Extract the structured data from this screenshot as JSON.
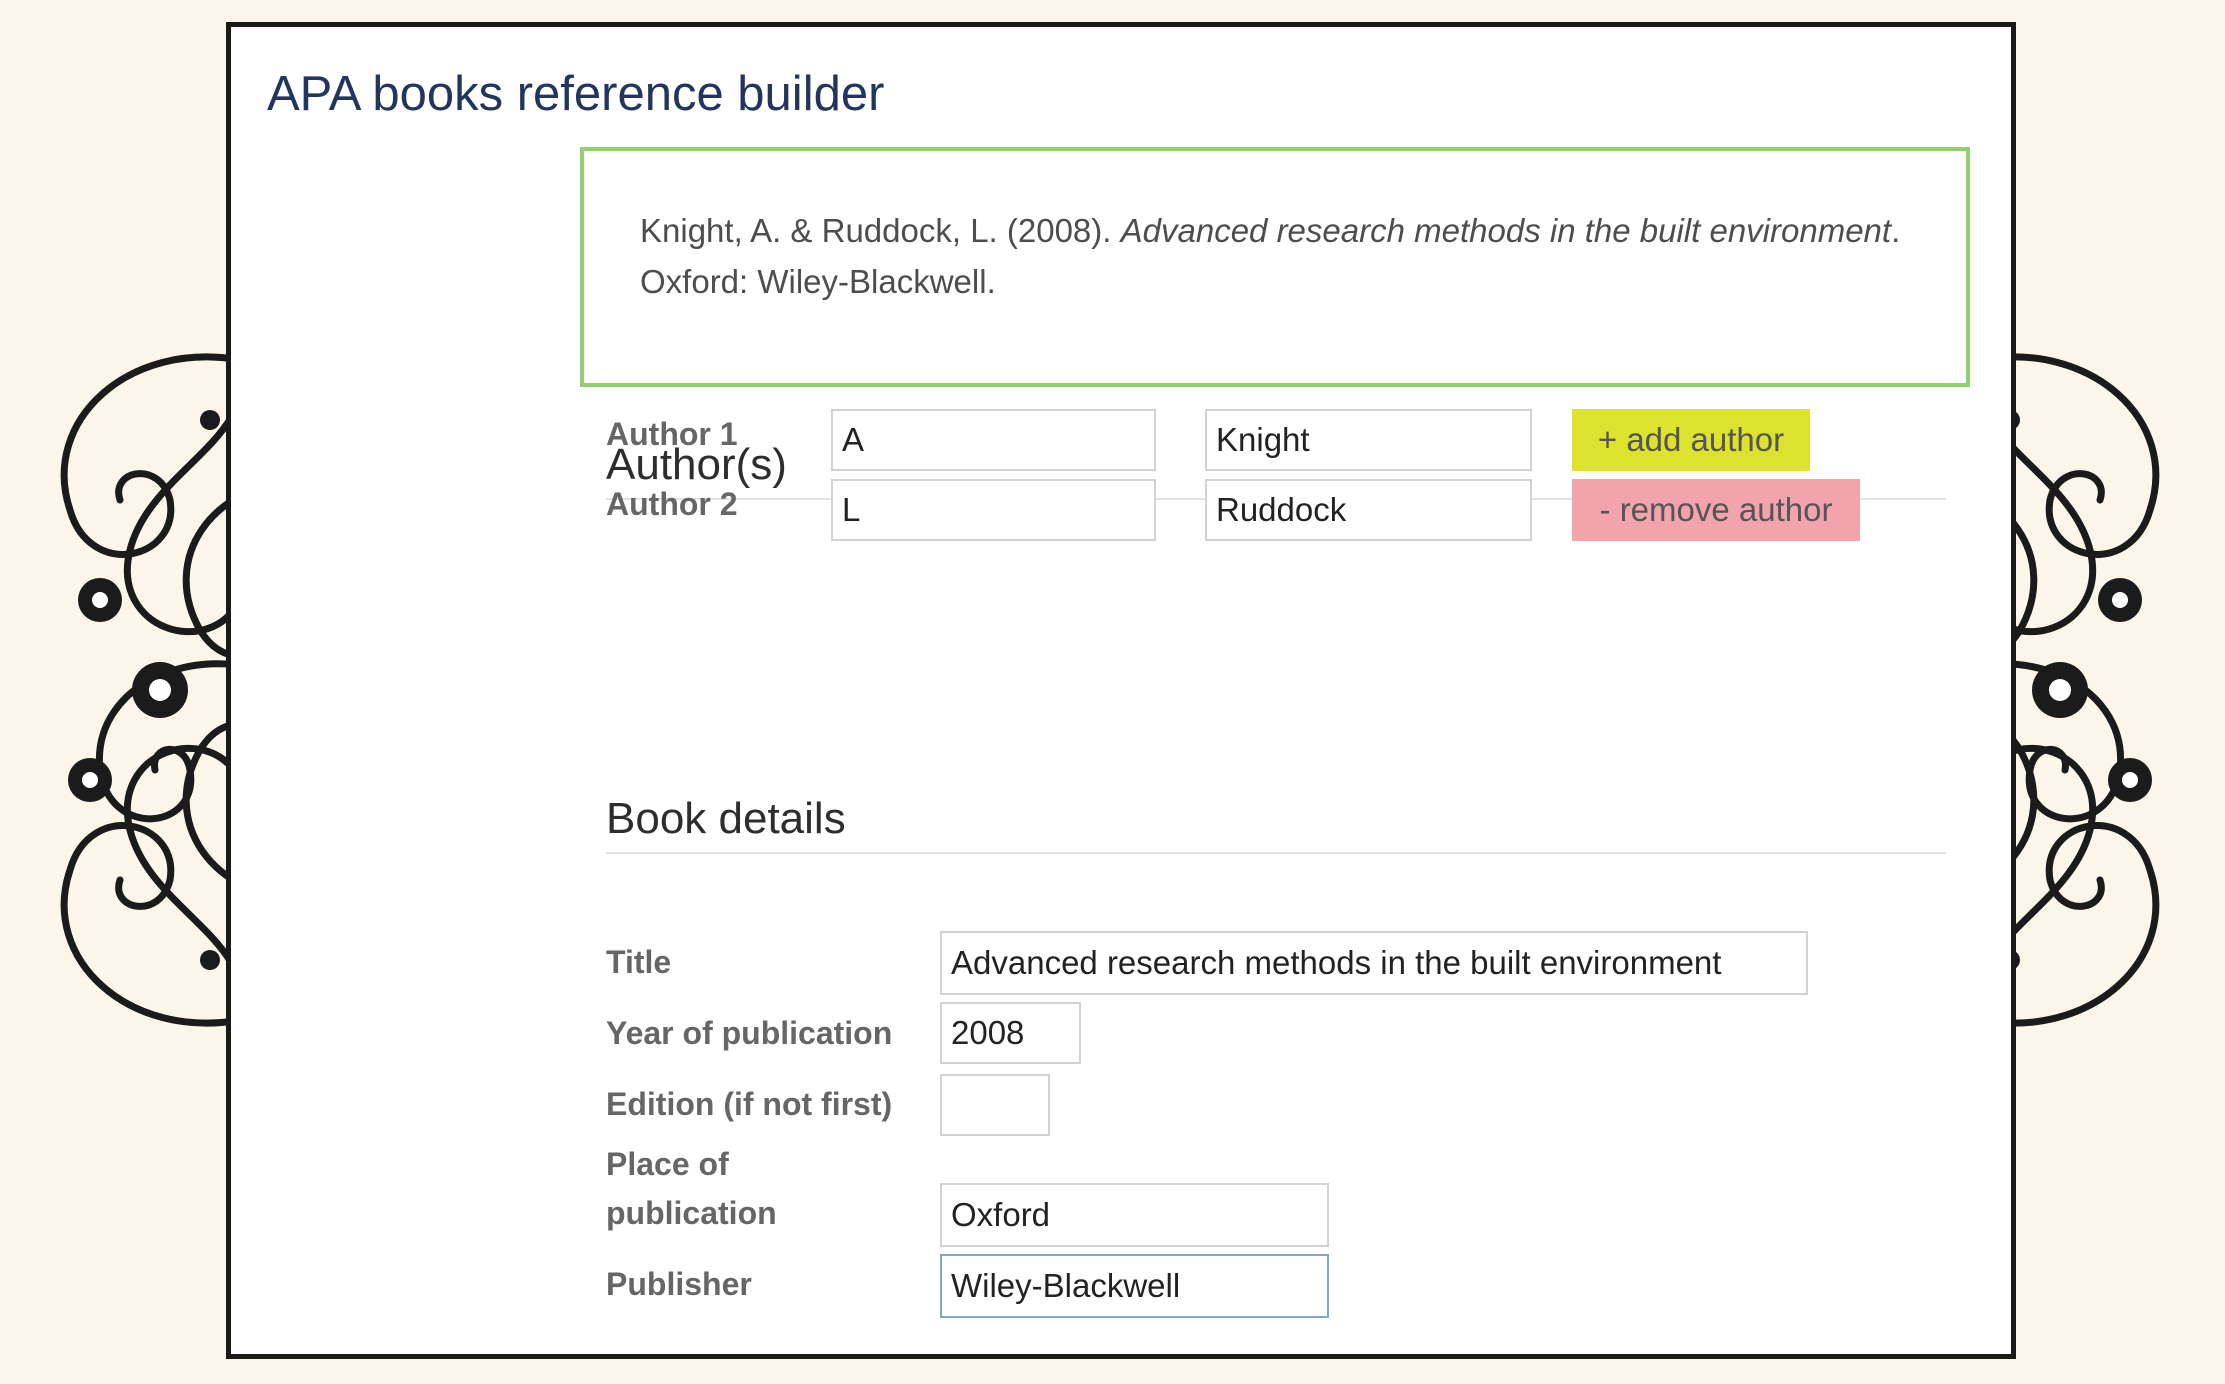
{
  "app": {
    "title": "APA books reference builder"
  },
  "reference_output": {
    "authors_year": "Knight, A. & Ruddock, L. (2008).",
    "title_italic": "Advanced research methods in the built environment",
    "publisher_info": ". Oxford: Wiley-Blackwell."
  },
  "authors_section": {
    "heading": "Author(s)",
    "authors": [
      {
        "label": "Author 1",
        "initials": "A",
        "surname": "Knight"
      },
      {
        "label": "Author 2",
        "initials": "L",
        "surname": "Ruddock"
      }
    ],
    "add_button_label": "+ add author",
    "remove_button_label": "- remove author"
  },
  "book_section": {
    "heading": "Book details",
    "title_label": "Title",
    "title_value": "Advanced research methods in the built environment",
    "year_label": "Year of publication",
    "year_value": "2008",
    "edition_label": "Edition (if not first)",
    "edition_value": "",
    "place_label_line1": "Place of",
    "place_label_line2": "publication",
    "place_value": "Oxford",
    "publisher_label": "Publisher",
    "publisher_value": "Wiley-Blackwell"
  },
  "colors": {
    "title_blue": "#23355f",
    "output_border_green": "#8fd16e",
    "add_button_yellow": "#dde22e",
    "remove_button_pink": "#f2a3ab",
    "page_background": "#fcf6ea"
  },
  "decorations": {
    "ornament_icon": "swirl-flourish-icon"
  }
}
